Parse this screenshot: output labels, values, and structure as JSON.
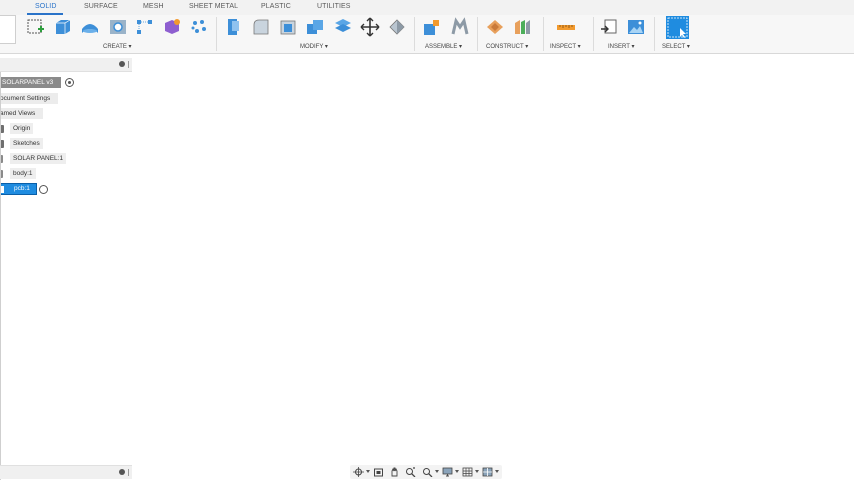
{
  "tabs": [
    {
      "label": "SOLID",
      "active": true
    },
    {
      "label": "SURFACE",
      "active": false
    },
    {
      "label": "MESH",
      "active": false
    },
    {
      "label": "SHEET METAL",
      "active": false
    },
    {
      "label": "PLASTIC",
      "active": false
    },
    {
      "label": "UTILITIES",
      "active": false
    }
  ],
  "ribbon": {
    "groups": [
      {
        "label": "CREATE ▾",
        "tools": [
          "create-sketch-icon",
          "extrude-icon",
          "revolve-icon",
          "hole-icon",
          "rectangular-pattern-icon",
          "create-form-icon",
          "pattern-icon"
        ]
      },
      {
        "label": "MODIFY ▾",
        "tools": [
          "press-pull-icon",
          "fillet-icon",
          "shell-icon",
          "combine-icon",
          "offset-face-icon",
          "move-icon",
          "split-icon"
        ]
      },
      {
        "label": "ASSEMBLE ▾",
        "tools": [
          "new-component-icon",
          "joint-icon"
        ]
      },
      {
        "label": "CONSTRUCT ▾",
        "tools": [
          "offset-plane-icon",
          "midplane-icon"
        ]
      },
      {
        "label": "INSPECT ▾",
        "tools": [
          "measure-icon"
        ]
      },
      {
        "label": "INSERT ▾",
        "tools": [
          "insert-derive-icon",
          "insert-image-icon"
        ]
      },
      {
        "label": "SELECT ▾",
        "tools": [
          "select-icon"
        ]
      }
    ]
  },
  "browser": {
    "root_label": "SOLARPANEL v3",
    "items": [
      {
        "label": "ocument Settings"
      },
      {
        "label": "amed Views"
      },
      {
        "label": "Origin"
      },
      {
        "label": "Sketches"
      },
      {
        "label": "SOLAR PANEL:1"
      },
      {
        "label": "body:1"
      },
      {
        "label": "pcb:1",
        "selected": true
      }
    ]
  },
  "colors": {
    "accent": "#2a73c9",
    "selection": "#1f8ce0",
    "root_bg": "#8a8a8a"
  }
}
